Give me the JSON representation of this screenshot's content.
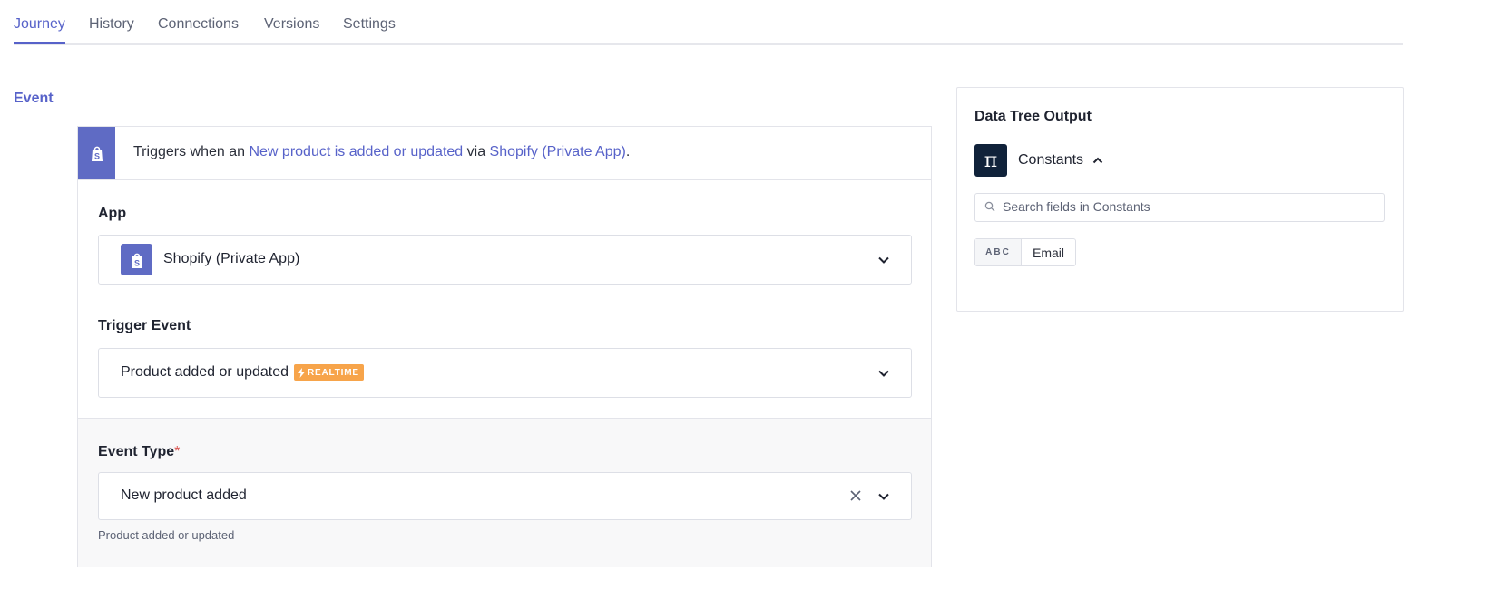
{
  "tabs": [
    {
      "label": "Journey",
      "active": true
    },
    {
      "label": "History",
      "active": false
    },
    {
      "label": "Connections",
      "active": false
    },
    {
      "label": "Versions",
      "active": false
    },
    {
      "label": "Settings",
      "active": false
    }
  ],
  "section_title": "Event",
  "trigger": {
    "prefix": "Triggers when an ",
    "event_link": "New product is added or updated",
    "middle": " via ",
    "app_link": "Shopify (Private App)",
    "suffix": ".",
    "icon": "shopify-bag-icon"
  },
  "app_field": {
    "label": "App",
    "value": "Shopify (Private App)",
    "icon": "shopify-bag-icon"
  },
  "trigger_event_field": {
    "label": "Trigger Event",
    "value": "Product added or updated",
    "badge": "REALTIME",
    "badge_icon": "lightning-icon"
  },
  "event_type_field": {
    "label": "Event Type",
    "required_mark": "*",
    "value": "New product added",
    "help_text": "Product added or updated"
  },
  "data_tree": {
    "title": "Data Tree Output",
    "group_label": "Constants",
    "group_icon": "pi-icon",
    "search_placeholder": "Search fields in Constants",
    "fields": [
      {
        "type": "ABC",
        "name": "Email"
      }
    ]
  },
  "colors": {
    "accent": "#5762c9",
    "shopify": "#5f6bc4",
    "badge": "#f7a44a",
    "pi_bg": "#10223a"
  }
}
